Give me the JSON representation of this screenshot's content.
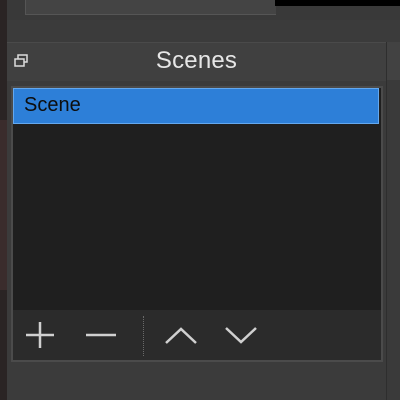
{
  "dock": {
    "title": "Scenes",
    "float_icon": "undock-icon"
  },
  "scenes": {
    "items": [
      {
        "label": "Scene",
        "selected": true
      }
    ]
  },
  "toolbar": {
    "buttons": [
      {
        "icon": "plus-icon",
        "action": "add-scene"
      },
      {
        "icon": "minus-icon",
        "action": "remove-scene"
      },
      {
        "icon": "chevron-up-icon",
        "action": "move-up"
      },
      {
        "icon": "chevron-down-icon",
        "action": "move-down"
      }
    ]
  },
  "colors": {
    "selection": "#2d7fd8",
    "list_bg": "#1f1f1f",
    "title_bg": "#404040",
    "text": "#e6e6e6"
  }
}
